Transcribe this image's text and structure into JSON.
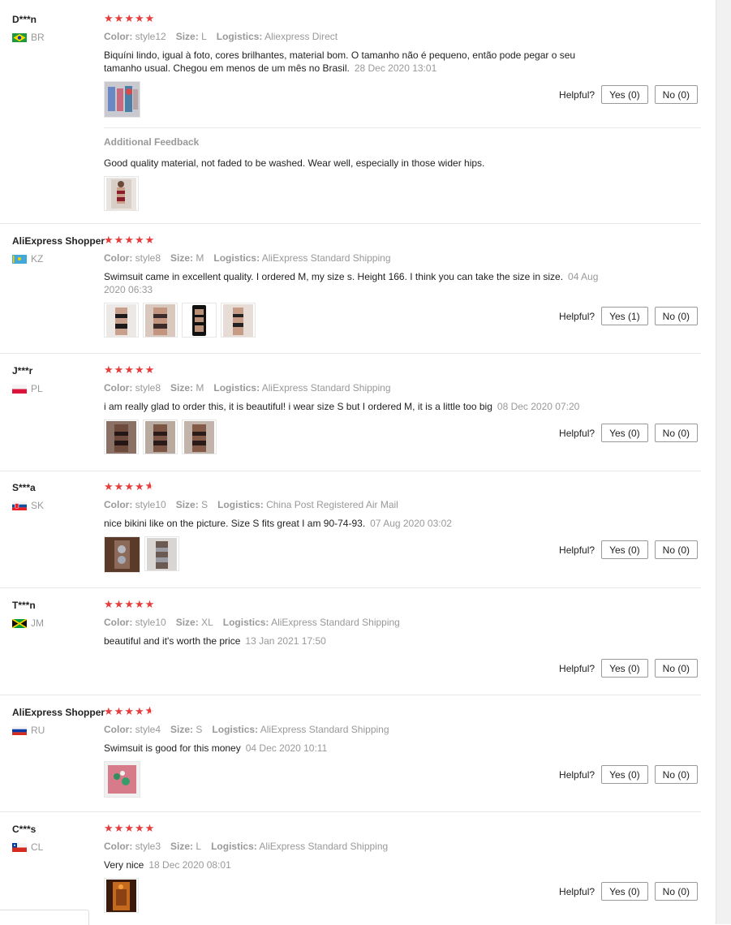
{
  "helpful_label": "Helpful?",
  "star_color": "#e63c3c",
  "reviews": [
    {
      "user": "D***n",
      "country": "BR",
      "flag": "brazil-flag-icon",
      "stars": 5,
      "color_label": "Color:",
      "color": "style12",
      "size_label": "Size:",
      "size": "L",
      "logistics_label": "Logistics:",
      "logistics": "Aliexpress Direct",
      "text": "Biquíni lindo, igual à foto, cores brilhantes, material bom. O tamanho não é pequeno, então pode pegar o seu tamanho usual. Chegou em menos de um mês no Brasil.",
      "date": "28 Dec 2020 13:01",
      "yes": "Yes (0)",
      "no": "No (0)",
      "additional": {
        "title": "Additional Feedback",
        "text": "Good quality material, not faded to be washed. Wear well, especially in those wider hips."
      }
    },
    {
      "user": "AliExpress Shopper",
      "country": "KZ",
      "flag": "kazakhstan-flag-icon",
      "stars": 5,
      "color_label": "Color:",
      "color": "style8",
      "size_label": "Size:",
      "size": "M",
      "logistics_label": "Logistics:",
      "logistics": "AliExpress Standard Shipping",
      "text": "Swimsuit came in excellent quality. I ordered M, my size s. Height 166. I think you can take the size in size.",
      "date": "04 Aug 2020 06:33",
      "yes": "Yes (1)",
      "no": "No (0)"
    },
    {
      "user": "J***r",
      "country": "PL",
      "flag": "poland-flag-icon",
      "stars": 5,
      "color_label": "Color:",
      "color": "style8",
      "size_label": "Size:",
      "size": "M",
      "logistics_label": "Logistics:",
      "logistics": "AliExpress Standard Shipping",
      "text": "i am really glad to order this, it is beautiful! i wear size S but I ordered M, it is a little too big",
      "date": "08 Dec 2020 07:20",
      "yes": "Yes (0)",
      "no": "No (0)"
    },
    {
      "user": "S***a",
      "country": "SK",
      "flag": "slovakia-flag-icon",
      "stars": 4.5,
      "color_label": "Color:",
      "color": "style10",
      "size_label": "Size:",
      "size": "S",
      "logistics_label": "Logistics:",
      "logistics": "China Post Registered Air Mail",
      "text": "nice bikini like on the picture. Size S fits great I am 90-74-93.",
      "date": "07 Aug 2020 03:02",
      "yes": "Yes (0)",
      "no": "No (0)"
    },
    {
      "user": "T***n",
      "country": "JM",
      "flag": "jamaica-flag-icon",
      "stars": 5,
      "color_label": "Color:",
      "color": "style10",
      "size_label": "Size:",
      "size": "XL",
      "logistics_label": "Logistics:",
      "logistics": "AliExpress Standard Shipping",
      "text": "beautiful and it's worth the price",
      "date": "13 Jan 2021 17:50",
      "yes": "Yes (0)",
      "no": "No (0)"
    },
    {
      "user": "AliExpress Shopper",
      "country": "RU",
      "flag": "russia-flag-icon",
      "stars": 4.5,
      "color_label": "Color:",
      "color": "style4",
      "size_label": "Size:",
      "size": "S",
      "logistics_label": "Logistics:",
      "logistics": "AliExpress Standard Shipping",
      "text": "Swimsuit is good for this money",
      "date": "04 Dec 2020 10:11",
      "yes": "Yes (0)",
      "no": "No (0)"
    },
    {
      "user": "C***s",
      "country": "CL",
      "flag": "chile-flag-icon",
      "stars": 5,
      "color_label": "Color:",
      "color": "style3",
      "size_label": "Size:",
      "size": "L",
      "logistics_label": "Logistics:",
      "logistics": "AliExpress Standard Shipping",
      "text": "Very nice",
      "date": "18 Dec 2020 08:01",
      "yes": "Yes (0)",
      "no": "No (0)"
    }
  ]
}
